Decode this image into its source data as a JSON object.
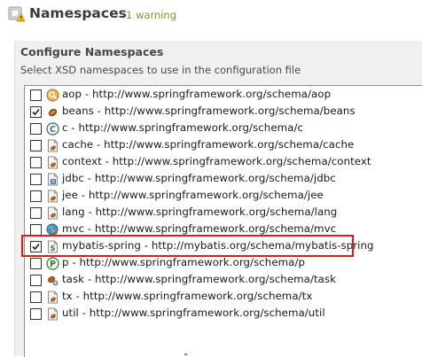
{
  "header": {
    "title": "Namespaces",
    "warning_count": "1 warning",
    "icon": "warning-icon"
  },
  "section": {
    "title": "Configure Namespaces",
    "description": "Select XSD namespaces to use in the configuration file"
  },
  "namespaces": [
    {
      "label": "aop - http://www.springframework.org/schema/aop",
      "checked": false,
      "icon": "aop-icon"
    },
    {
      "label": "beans - http://www.springframework.org/schema/beans",
      "checked": true,
      "icon": "bean-icon"
    },
    {
      "label": "c - http://www.springframework.org/schema/c",
      "checked": false,
      "icon": "c-namespace-icon"
    },
    {
      "label": "cache - http://www.springframework.org/schema/cache",
      "checked": false,
      "icon": "cache-icon"
    },
    {
      "label": "context - http://www.springframework.org/schema/context",
      "checked": false,
      "icon": "context-icon"
    },
    {
      "label": "jdbc - http://www.springframework.org/schema/jdbc",
      "checked": false,
      "icon": "jdbc-icon"
    },
    {
      "label": "jee - http://www.springframework.org/schema/jee",
      "checked": false,
      "icon": "jee-icon"
    },
    {
      "label": "lang - http://www.springframework.org/schema/lang",
      "checked": false,
      "icon": "lang-icon"
    },
    {
      "label": "mvc - http://www.springframework.org/schema/mvc",
      "checked": false,
      "icon": "mvc-icon"
    },
    {
      "label": "mybatis-spring - http://mybatis.org/schema/mybatis-spring",
      "checked": true,
      "icon": "schema-file-icon"
    },
    {
      "label": "p - http://www.springframework.org/schema/p",
      "checked": false,
      "icon": "p-namespace-icon"
    },
    {
      "label": "task - http://www.springframework.org/schema/task",
      "checked": false,
      "icon": "task-icon"
    },
    {
      "label": "tx - http://www.springframework.org/schema/tx",
      "checked": false,
      "icon": "tx-icon"
    },
    {
      "label": "util - http://www.springframework.org/schema/util",
      "checked": false,
      "icon": "util-icon"
    }
  ],
  "colors": {
    "highlight": "#e31a1c",
    "warning_text": "#7a9a2a"
  }
}
